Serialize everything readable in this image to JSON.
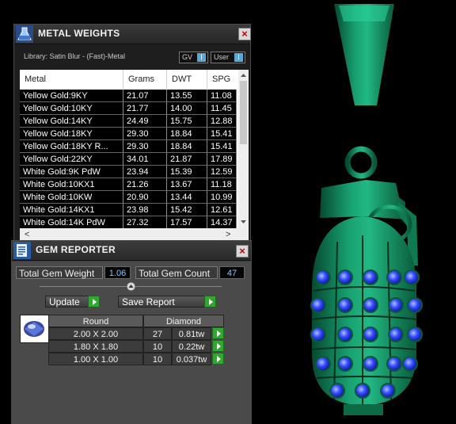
{
  "metal_weights": {
    "title": "METAL WEIGHTS",
    "library": "Library: Satin Blur - (Fast)-Metal",
    "toggle_gv": "GV",
    "toggle_user": "User",
    "knob": "I",
    "columns": [
      "Metal",
      "Grams",
      "DWT",
      "SPG"
    ],
    "rows": [
      [
        "Yellow Gold:9KY",
        "21.07",
        "13.55",
        "11.08"
      ],
      [
        "Yellow Gold:10KY",
        "21.77",
        "14.00",
        "11.45"
      ],
      [
        "Yellow Gold:14KY",
        "24.49",
        "15.75",
        "12.88"
      ],
      [
        "Yellow Gold:18KY",
        "29.30",
        "18.84",
        "15.41"
      ],
      [
        "Yellow Gold:18KY R...",
        "29.30",
        "18.84",
        "15.41"
      ],
      [
        "Yellow Gold:22KY",
        "34.01",
        "21.87",
        "17.89"
      ],
      [
        "White Gold:9K PdW",
        "23.94",
        "15.39",
        "12.59"
      ],
      [
        "White Gold:10KX1",
        "21.26",
        "13.67",
        "11.18"
      ],
      [
        "White Gold:10KW",
        "20.90",
        "13.44",
        "10.99"
      ],
      [
        "White Gold:14KX1",
        "23.98",
        "15.42",
        "12.61"
      ],
      [
        "White Gold:14K PdW",
        "27.32",
        "17.57",
        "14.37"
      ]
    ],
    "scroll_left": "<",
    "scroll_right": ">"
  },
  "gem_reporter": {
    "title": "GEM REPORTER",
    "total_weight_label": "Total Gem Weight",
    "total_weight_value": "1.06",
    "total_count_label": "Total Gem Count",
    "total_count_value": "47",
    "update_label": "Update",
    "save_report_label": "Save Report",
    "table_headers": [
      "Round",
      "Diamond"
    ],
    "gem_rows": [
      {
        "size": "2.00 X 2.00",
        "count": "27",
        "weight": "0.81tw"
      },
      {
        "size": "1.80 X 1.80",
        "count": "10",
        "weight": "0.22tw"
      },
      {
        "size": "1.00 X 1.00",
        "count": "10",
        "weight": "0.037tw"
      }
    ]
  },
  "colors": {
    "metal": "#118a5c",
    "gem": "#2e3cff",
    "accent_blue": "#7ec8ff",
    "button_green": "#2ea82e"
  }
}
